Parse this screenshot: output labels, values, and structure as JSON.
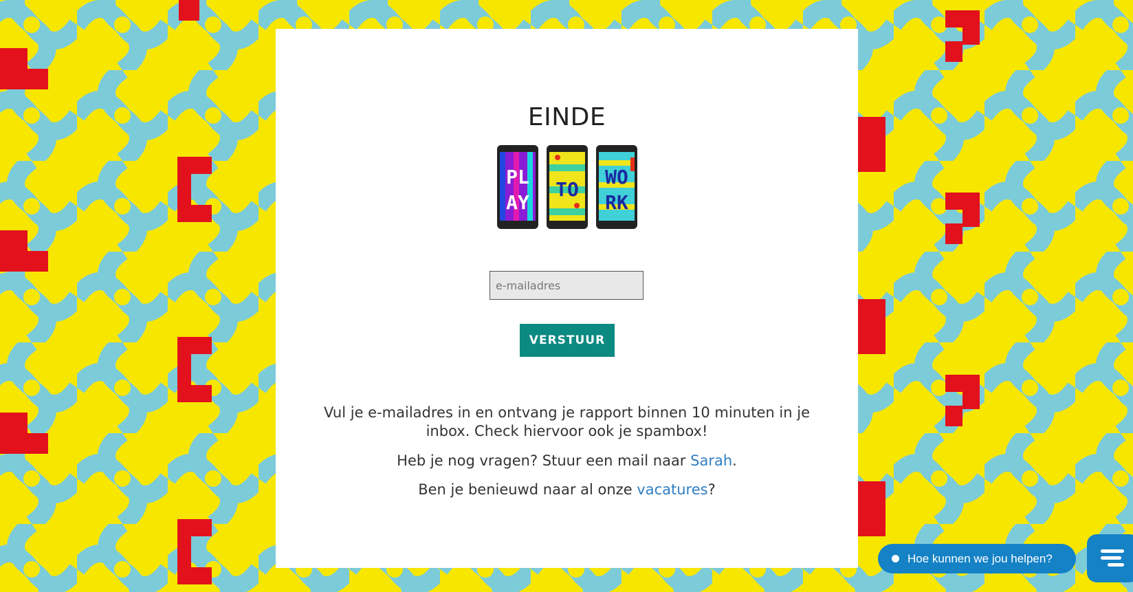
{
  "page": {
    "title": "EINDE",
    "logo_alt": "PLAY TO WORK"
  },
  "form": {
    "email_placeholder": "e-mailadres",
    "submit_label": "VERSTUUR"
  },
  "info": {
    "line1": "Vul je e-mailadres in en ontvang je rapport binnen 10 minuten in je inbox. Check hiervoor ook je spambox!",
    "line2_prefix": "Heb je nog vragen? Stuur een mail naar ",
    "line2_link": "Sarah",
    "line2_suffix": ".",
    "line3_prefix": "Ben je benieuwd naar al onze ",
    "line3_link": "vacatures",
    "line3_suffix": "?"
  },
  "chat": {
    "prompt": "Hoe kunnen we jou helpen?",
    "icon": "chat-lines-icon"
  },
  "colors": {
    "background_yellow": "#f7e700",
    "background_blue": "#7ccbd9",
    "background_red": "#e3111b",
    "button": "#0b8a82",
    "link": "#2f7ec1",
    "chat": "#1582c6"
  }
}
